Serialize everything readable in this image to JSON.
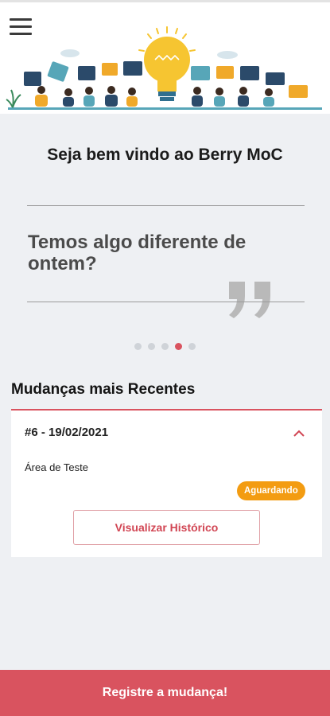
{
  "header": {
    "menu_icon": "hamburger-menu-icon",
    "illustration": "people-with-lightbulb-illustration"
  },
  "welcome": "Seja bem vindo ao Berry MoC",
  "carousel": {
    "slide_text": "Temos algo diferente de ontem?",
    "quote_icon": "closing-quote-icon",
    "page_count": 5,
    "active_index": 3
  },
  "section_title": "Mudanças mais Recentes",
  "card": {
    "id_date": "#6 - 19/02/2021",
    "area": "Área de Teste",
    "status": "Aguardando",
    "history_button": "Visualizar Histórico",
    "expand_icon": "chevron-up-icon"
  },
  "cta": "Registre a mudança!",
  "colors": {
    "accent": "#d9535f",
    "status_pending": "#f39c12",
    "background": "#eef0f3"
  }
}
